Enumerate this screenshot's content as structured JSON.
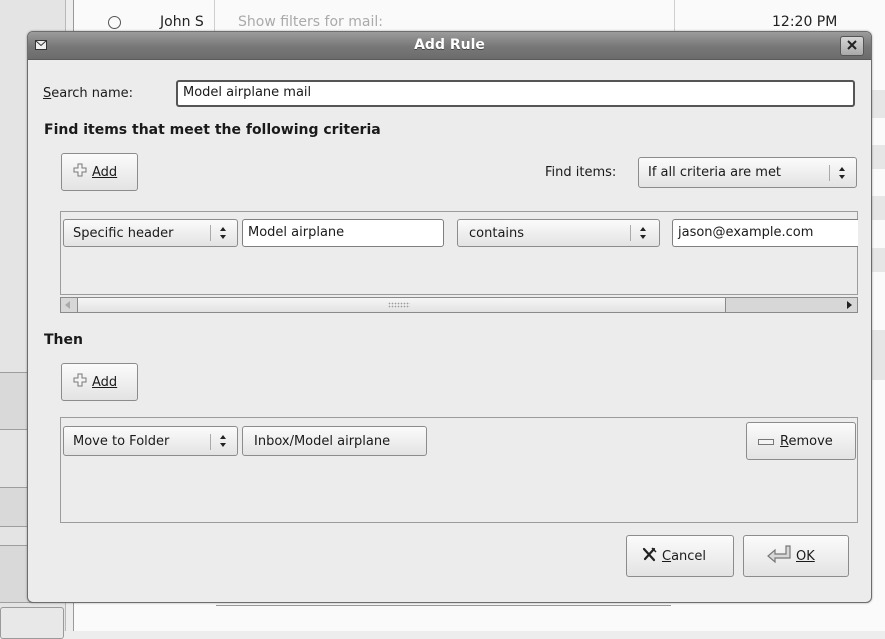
{
  "background": {
    "row": {
      "sender": "John S",
      "faint_text": "Show filters for mail:",
      "time": "12:20 PM"
    }
  },
  "dialog": {
    "title": "Add Rule",
    "search_name_label": "Search name:",
    "search_name_value": "Model airplane mail",
    "criteria_heading": "Find items that meet the following criteria",
    "add_label": "Add",
    "find_items_label": "Find items:",
    "find_items_value": "If all criteria are met",
    "criteria_row": {
      "field": "Specific header",
      "header_name": "Model airplane",
      "operator": "contains",
      "value": "jason@example.com"
    },
    "then_heading": "Then",
    "action_row": {
      "action": "Move to Folder",
      "folder": "Inbox/Model airplane",
      "remove_label": "Remove"
    },
    "cancel_label": "Cancel",
    "ok_label": "OK"
  },
  "icons": {
    "window": "envelope-icon",
    "close": "close-icon",
    "add": "plus-icon",
    "remove": "minus-icon",
    "cancel": "cancel-x-icon",
    "ok": "return-arrow-icon",
    "combo": "up-down-arrows-icon"
  },
  "colors": {
    "titlebar": "#777777",
    "dialog_bg": "#ececec"
  }
}
